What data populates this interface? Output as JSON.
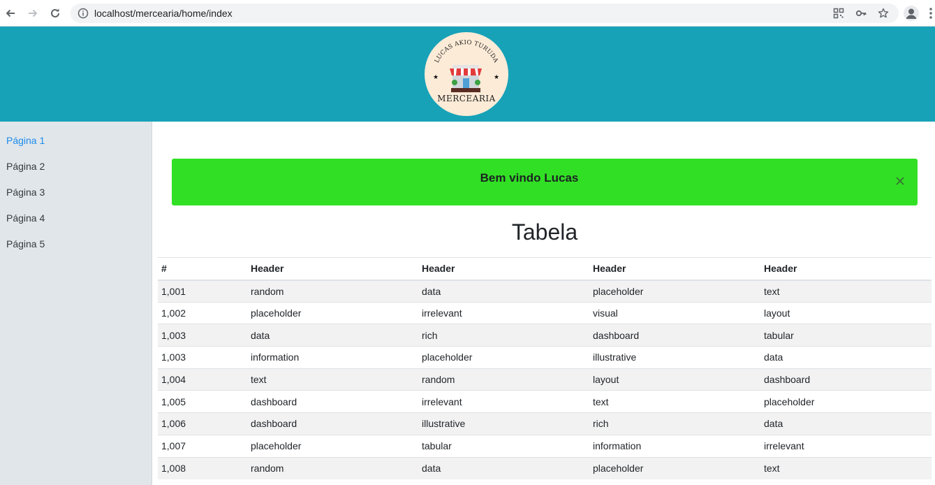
{
  "browser": {
    "url": "localhost/mercearia/home/index"
  },
  "logo": {
    "owner_name": "LUCAS AKIO TURUDA",
    "store_name": "MERCEARIA"
  },
  "sidebar": {
    "items": [
      {
        "label": "Página 1",
        "active": true
      },
      {
        "label": "Página 2",
        "active": false
      },
      {
        "label": "Página 3",
        "active": false
      },
      {
        "label": "Página 4",
        "active": false
      },
      {
        "label": "Página 5",
        "active": false
      }
    ]
  },
  "alert": {
    "message": "Bem vindo Lucas",
    "close_symbol": "×"
  },
  "main": {
    "title": "Tabela"
  },
  "table": {
    "headers": [
      "#",
      "Header",
      "Header",
      "Header",
      "Header"
    ],
    "rows": [
      [
        "1,001",
        "random",
        "data",
        "placeholder",
        "text"
      ],
      [
        "1,002",
        "placeholder",
        "irrelevant",
        "visual",
        "layout"
      ],
      [
        "1,003",
        "data",
        "rich",
        "dashboard",
        "tabular"
      ],
      [
        "1,003",
        "information",
        "placeholder",
        "illustrative",
        "data"
      ],
      [
        "1,004",
        "text",
        "random",
        "layout",
        "dashboard"
      ],
      [
        "1,005",
        "dashboard",
        "irrelevant",
        "text",
        "placeholder"
      ],
      [
        "1,006",
        "dashboard",
        "illustrative",
        "rich",
        "data"
      ],
      [
        "1,007",
        "placeholder",
        "tabular",
        "information",
        "irrelevant"
      ],
      [
        "1,008",
        "random",
        "data",
        "placeholder",
        "text"
      ]
    ]
  },
  "colors": {
    "banner": "#17a2b8",
    "alert": "#31e024",
    "sidebar": "#e1e6ea",
    "active_link": "#1b8cec"
  },
  "icons": {
    "back": "back-arrow-icon",
    "forward": "forward-arrow-icon",
    "reload": "reload-icon",
    "info": "info-icon",
    "qr": "qr-code-icon",
    "key": "key-icon",
    "star": "star-icon",
    "profile": "profile-icon",
    "menu": "kebab-menu-icon"
  }
}
